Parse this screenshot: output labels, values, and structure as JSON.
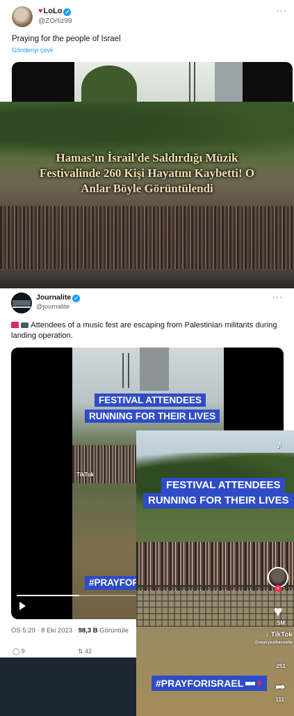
{
  "tweet1": {
    "display_name": "LoLo",
    "handle": "@ZOrtiz99",
    "text": "Praying for the people of Israel",
    "translate_label": "Gönderiyi çevir",
    "more_label": "···"
  },
  "video_frame_1": {
    "caption_line1": "Hamas'ın İsrail'de Saldırdığı Müzik",
    "caption_line2": "Festivalinde 260 Kişi Hayatını Kaybetti! O",
    "caption_line3": "Anlar Böyle Görüntülendi"
  },
  "tweet2": {
    "display_name": "Journalite",
    "handle": "@journalite",
    "more_label": "···",
    "text": "Attendees of a music fest are escaping from Palestinian militants during landing operation.",
    "video": {
      "band_line1": "FESTIVAL ATTENDEES",
      "band_line2": "RUNNING FOR THEIR LIVES",
      "hashtag": "#PRAYFOR",
      "tiktok_label": "TikTok",
      "progress": 0.24
    },
    "meta": {
      "time": "ÖS 5:29 · 8 Eki 2023 · ",
      "views": "98,3 B",
      "views_label": " Görüntüle"
    },
    "actions": {
      "reply_count": "9",
      "retweet_count": "42"
    }
  },
  "tiktok_frame": {
    "band_line1": "FESTIVAL ATTENDEES",
    "band_line2": "RUNNING FOR THEIR LIVES",
    "hashtag": "#PRAYFORISRAEL",
    "likes": "5M",
    "watermark": "TikTok",
    "handle": "@nearyesthecoolie",
    "comments": "251",
    "shares": "111"
  },
  "icons": {
    "verified": "verified-badge-icon",
    "more": "more-icon",
    "play": "play-icon",
    "tiktok": "tiktok-logo-icon",
    "heart": "heart-icon",
    "share": "share-icon"
  },
  "colors": {
    "link_blue": "#1d9bf0",
    "caption_band_blue": "#2f4cc7",
    "dark_background": "#1c2733",
    "heart_red": "#e0245e"
  }
}
